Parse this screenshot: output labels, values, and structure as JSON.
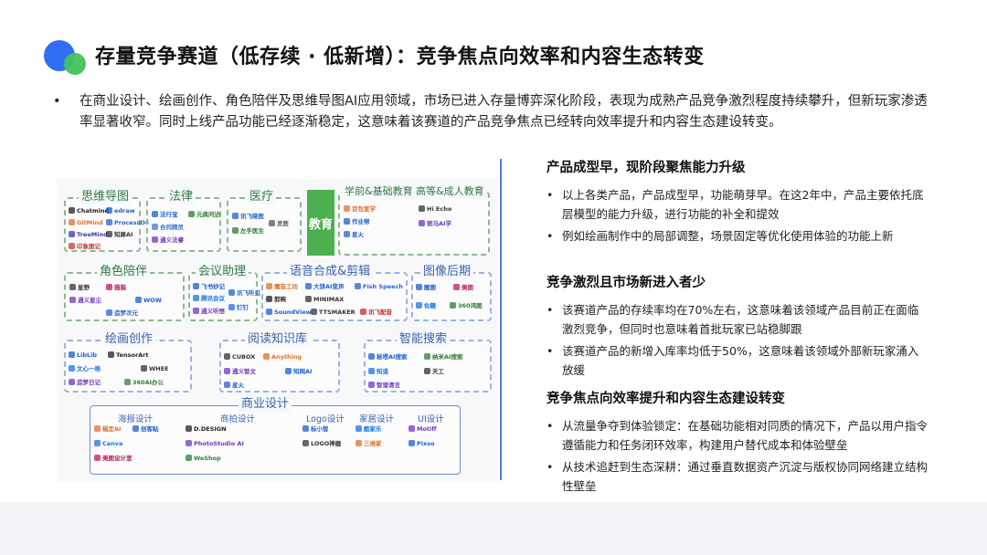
{
  "title": "存量竞争赛道（低存续 · 低新增）：竞争焦点向效率和内容生态转变",
  "intro": {
    "bullet": "•",
    "text": "在商业设计、绘画创作、角色陪伴及思维导图AI应用领域，市场已进入存量博弈深化阶段，表现为成熟产品竞争激烈程度持续攀升，但新玩家渗透率显著收窄。同时上线产品功能已经逐渐稳定，这意味着该赛道的产品竞争焦点已经转向效率提升和内容生态建设转变。"
  },
  "map": {
    "categories": {
      "mindmap": "思维导图",
      "law": "法律",
      "medical": "医疗",
      "education_tag": "教育",
      "education": "学前&基础教育 高等&成人教育",
      "companion": "角色陪伴",
      "meeting": "会议助理",
      "speech": "语音合成&剪辑",
      "image_post": "图像后期",
      "drawing": "绘画创作",
      "reading": "阅读知识库",
      "search": "智能搜索",
      "commercial": "商业设计",
      "poster": "海报设计",
      "product_image": "商拍设计",
      "logo": "Logo设计",
      "home": "家居设计",
      "ui": "UI设计"
    },
    "logos": {
      "mindmap": [
        "Chatmind",
        "edraw",
        "GitMind",
        "ProcessOn",
        "TreeMind",
        "知犀AI",
        "印象图记"
      ],
      "law": [
        "法行宝",
        "合同精灵",
        "通义法睿",
        "元典问达"
      ],
      "medical": [
        "讯飞晓医",
        "左手医生",
        "灵医"
      ],
      "education": [
        "豆包爱学",
        "作业帮",
        "星火",
        "Hi Echo",
        "斑马AI学"
      ],
      "companion": [
        "星野",
        "猫箱",
        "通义星尘",
        "WOW",
        "造梦次元"
      ],
      "meeting": [
        "飞书妙记",
        "腾讯会议",
        "通义听悟",
        "讯飞听见",
        "钉钉"
      ],
      "speech": [
        "魔音工坊",
        "大饼AI变声",
        "Fish Speech",
        "剪映",
        "MINIMAX",
        "SoundView",
        "TTSMAKER",
        "讯飞配音"
      ],
      "image_post": [
        "醒图",
        "美图",
        "佐糖",
        "360鸿图"
      ],
      "drawing": [
        "LibLib",
        "TensorArt",
        "文心一格",
        "WHEE",
        "造梦日记",
        "360AI办公"
      ],
      "reading": [
        "CUBOX",
        "Anything",
        "通义智文",
        "知网AI",
        "星火"
      ],
      "search": [
        "秘塔AI搜索",
        "纳米AI搜索",
        "知道",
        "天工",
        "智谱清言"
      ],
      "poster": [
        "稿定AI",
        "创客贴",
        "Canva",
        "美图设计室"
      ],
      "product_image": [
        "D.DESIGN",
        "PhotoStudio AI",
        "WeShop"
      ],
      "logo": [
        "标小智",
        "LOGO神器"
      ],
      "home": [
        "酷家乐",
        "三维家"
      ],
      "ui": [
        "Motiff",
        "Pixso"
      ]
    }
  },
  "sections": [
    {
      "title": "产品成型早，现阶段聚焦能力升级",
      "items": [
        "以上各类产品，产品成型早，功能萌芽早。在这2年中，产品主要依托底层模型的能力升级，进行功能的补全和提效",
        "例如绘画制作中的局部调整，场景固定等优化使用体验的功能上新"
      ]
    },
    {
      "title": "竞争激烈且市场新进入者少",
      "items": [
        "该赛道产品的存续率均在70%左右，这意味着该领域产品目前正在面临激烈竞争，但同时也意味着首批玩家已站稳脚跟",
        "该赛道产品的新增入库率均低于50%，这意味着该领域外部新玩家涌入放缓"
      ]
    },
    {
      "title": "竞争焦点向效率提升和内容生态建设转变",
      "items": [
        "从流量争夺到体验锁定：在基础功能相对同质的情况下，产品以用户指令遵循能力和任务闭环效率，构建用户替代成本和体验壁垒",
        "从技术追赶到生态深耕：通过垂直数据资产沉淀与版权协同网络建立结构性壁垒"
      ]
    }
  ],
  "bullet": "•",
  "colors": {
    "accent": "#2f6ef5",
    "green": "#43c35a",
    "divider": "#4a7fd1"
  }
}
